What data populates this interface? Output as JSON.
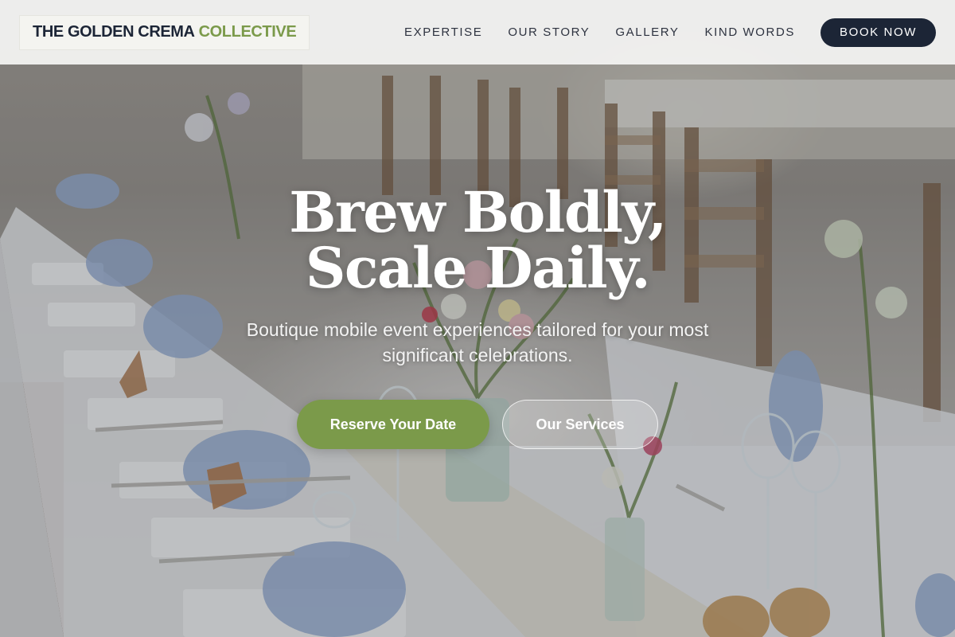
{
  "brand": {
    "name_main": "THE GOLDEN CREMA",
    "name_accent": "COLLECTIVE",
    "accent_color": "#7b9a4a",
    "navy_color": "#1c2536"
  },
  "nav": {
    "links": [
      "EXPERTISE",
      "OUR STORY",
      "GALLERY",
      "KIND WORDS"
    ],
    "cta_label": "BOOK NOW"
  },
  "hero": {
    "headline_line1": "Brew Boldly,",
    "headline_line2": "Scale Daily.",
    "subheadline": "Boutique mobile event experiences tailored for your most significant celebrations.",
    "primary_cta": "Reserve Your Date",
    "secondary_cta": "Our Services",
    "background_image": "banquet-table-photo"
  }
}
